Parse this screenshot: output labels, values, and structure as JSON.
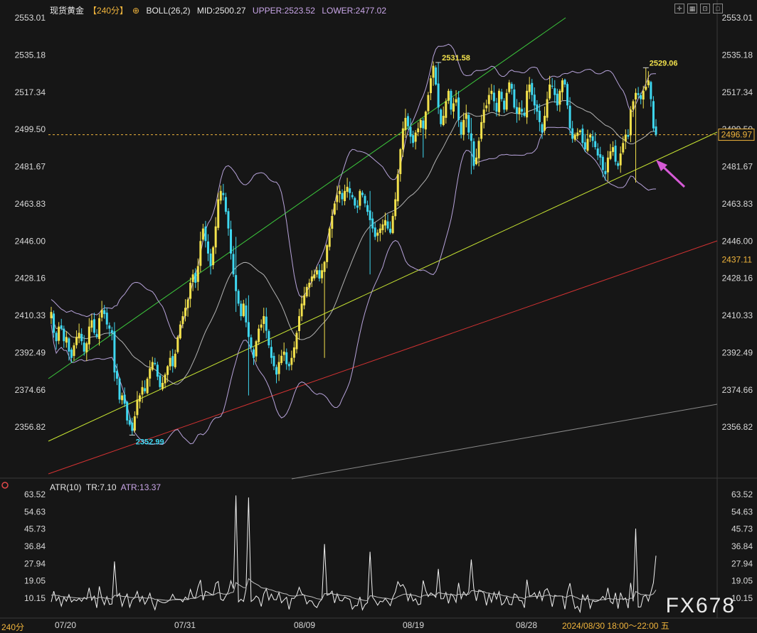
{
  "header": {
    "symbol": "现货黄金",
    "timeframe": "【240分】",
    "settings_icon": "⊕",
    "indicator": "BOLL(26,2)",
    "mid": "MID:2500.27",
    "upper": "UPPER:2523.52",
    "lower": "LOWER:2477.02"
  },
  "atr_header": {
    "name": "ATR(10)",
    "tr": "TR:7.10",
    "atr": "ATR:13.37"
  },
  "bottom_timeframe": "240分",
  "datetime_label": "2024/08/30 18:00～22:00 五",
  "watermark": "FX678",
  "colors": {
    "background": "#161616",
    "bull": "#f2e14c",
    "bear": "#3ed7f0",
    "boll": "#b7a3da",
    "green_line": "#3cc83c",
    "yellow_line": "#c9e632",
    "red_line": "#d23232",
    "gray_line": "#8a8a8a",
    "arrow": "#d65ad6",
    "price_tag": "#f0b43c"
  },
  "chart_data": {
    "type": "candlestick",
    "title": "现货黄金 240分",
    "x_tick_labels": [
      "07/20",
      "07/31",
      "08/09",
      "08/19",
      "08/28"
    ],
    "y_ticks": [
      2553.01,
      2535.18,
      2517.34,
      2499.5,
      2481.67,
      2463.83,
      2446.0,
      2428.16,
      2410.33,
      2392.49,
      2374.66,
      2356.82
    ],
    "y_range": [
      2347.0,
      2553.01
    ],
    "current_price": "2496.97",
    "price_level_tag": "2437.11",
    "annotations": [
      {
        "label": "2531.58",
        "price": 2531.58,
        "kind": "high"
      },
      {
        "label": "2529.06",
        "price": 2529.06,
        "kind": "high"
      },
      {
        "label": "2352.99",
        "price": 2352.99,
        "kind": "low"
      }
    ],
    "candles_close": [
      2412,
      2402,
      2398,
      2405,
      2404,
      2398,
      2400,
      2393,
      2390,
      2396,
      2400,
      2402,
      2398,
      2393,
      2397,
      2405,
      2408,
      2402,
      2400,
      2409,
      2413,
      2411,
      2406,
      2404,
      2402,
      2383,
      2380,
      2370,
      2372,
      2368,
      2360,
      2358,
      2355,
      2362,
      2370,
      2372,
      2376,
      2374,
      2380,
      2385,
      2388,
      2387,
      2381,
      2376,
      2378,
      2382,
      2386,
      2390,
      2386,
      2392,
      2400,
      2406,
      2410,
      2414,
      2418,
      2426,
      2430,
      2426,
      2434,
      2446,
      2452,
      2446,
      2440,
      2434,
      2443,
      2453,
      2466,
      2470,
      2468,
      2460,
      2452,
      2440,
      2430,
      2422,
      2416,
      2410,
      2416,
      2407,
      2400,
      2395,
      2390,
      2398,
      2404,
      2406,
      2410,
      2403,
      2396,
      2390,
      2386,
      2382,
      2388,
      2391,
      2393,
      2387,
      2386,
      2390,
      2395,
      2402,
      2410,
      2416,
      2420,
      2424,
      2426,
      2429,
      2430,
      2432,
      2428,
      2432,
      2436,
      2444,
      2452,
      2458,
      2464,
      2468,
      2470,
      2466,
      2470,
      2472,
      2469,
      2467,
      2463,
      2462,
      2470,
      2468,
      2464,
      2460,
      2456,
      2452,
      2448,
      2450,
      2452,
      2454,
      2456,
      2452,
      2450,
      2458,
      2466,
      2478,
      2490,
      2500,
      2505,
      2501,
      2496,
      2493,
      2498,
      2500,
      2504,
      2500,
      2508,
      2516,
      2524,
      2530,
      2521,
      2510,
      2502,
      2506,
      2513,
      2518,
      2509,
      2512,
      2514,
      2504,
      2497,
      2504,
      2507,
      2498,
      2494,
      2482,
      2486,
      2494,
      2503,
      2509,
      2511,
      2516,
      2518,
      2513,
      2508,
      2518,
      2514,
      2509,
      2517,
      2522,
      2519,
      2510,
      2507,
      2510,
      2508,
      2506,
      2518,
      2521,
      2516,
      2511,
      2508,
      2503,
      2498,
      2506,
      2514,
      2521,
      2520,
      2516,
      2511,
      2518,
      2523,
      2521,
      2511,
      2500,
      2495,
      2497,
      2498,
      2499,
      2493,
      2490,
      2495,
      2497,
      2494,
      2491,
      2487,
      2486,
      2480,
      2478,
      2486,
      2489,
      2491,
      2484,
      2482,
      2488,
      2493,
      2497,
      2496,
      2509,
      2513,
      2517,
      2516,
      2514,
      2518,
      2520,
      2523,
      2514,
      2500,
      2496.97
    ],
    "atr_y_ticks": [
      63.52,
      54.63,
      45.73,
      36.84,
      27.94,
      19.05,
      10.15
    ],
    "atr_values": "TR series oscillating between ~5 and ~63; ATR(10) smooth series ending at 13.37"
  }
}
